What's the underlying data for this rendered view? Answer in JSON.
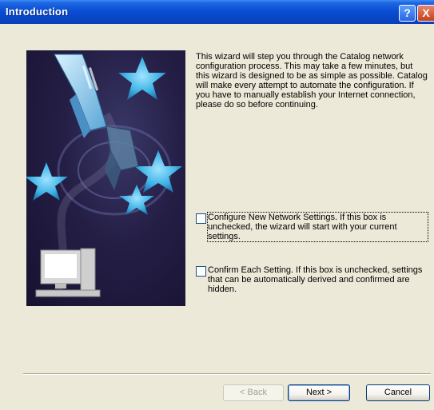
{
  "window": {
    "title": "Introduction",
    "help_glyph": "?",
    "close_glyph": "X"
  },
  "intro_text": "This wizard will step you through the Catalog network configuration process.  This may take a few minutes, but this wizard is designed to be as simple as possible.  Catalog will make every attempt to automate the configuration.  If you have to manually establish your Internet connection, please do so before continuing.",
  "options": [
    {
      "label": "Configure New Network Settings.  If this box is unchecked, the wizard will start with your current settings.",
      "checked": false
    },
    {
      "label": "Confirm Each Setting.  If this box is unchecked, settings that can be automatically derived and confirmed are hidden.",
      "checked": false
    }
  ],
  "buttons": {
    "back": "< Back",
    "next": "Next >",
    "cancel": "Cancel"
  },
  "colors": {
    "titlebar": "#0a4fd6",
    "background": "#ece9d8",
    "star": "#3fb4e6"
  },
  "icons": [
    "help-icon",
    "close-icon",
    "star-icon",
    "network-cable-icon",
    "computer-icon"
  ]
}
